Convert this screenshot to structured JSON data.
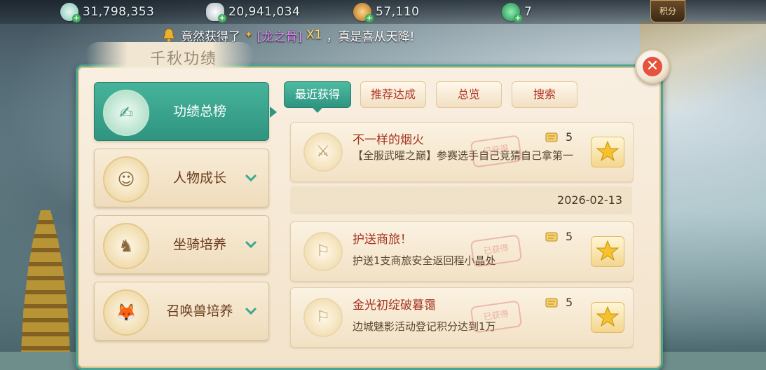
{
  "resources": [
    {
      "icon": "jade-coin-icon",
      "value": "31,798,353",
      "color": "#9ed3c6"
    },
    {
      "icon": "silver-ingot-icon",
      "value": "20,941,034",
      "color": "#cfd8dc"
    },
    {
      "icon": "copper-coin-icon",
      "value": "57,110",
      "color": "#d79a3a"
    },
    {
      "icon": "green-gem-icon",
      "value": "7",
      "color": "#2fae66"
    }
  ],
  "jifen_label": "积分",
  "notice": {
    "prefix": "竟然获得了",
    "item": "[龙之骨]",
    "qty": "X1",
    "suffix": "，真是喜从天降!"
  },
  "panel_title": "千秋功绩",
  "categories": [
    {
      "label": "功绩总榜",
      "active": true
    },
    {
      "label": "人物成长",
      "active": false
    },
    {
      "label": "坐骑培养",
      "active": false
    },
    {
      "label": "召唤兽培养",
      "active": false
    }
  ],
  "tabs": [
    {
      "label": "最近获得",
      "active": true
    },
    {
      "label": "推荐达成",
      "active": false
    },
    {
      "label": "总览",
      "active": false
    },
    {
      "label": "搜索",
      "active": false
    }
  ],
  "entries": [
    {
      "name": "不一样的烟火",
      "desc": "【全服武曜之巅】参赛选手自己竞猜自己拿第一",
      "points": "5",
      "stamp": "已获得"
    },
    {
      "name": "护送商旅！",
      "desc": "护送1支商旅安全返回程小晶处",
      "points": "5",
      "stamp": "已获得"
    },
    {
      "name": "金光初绽破暮霭",
      "desc": "边城魅影活动登记积分达到1万",
      "points": "5",
      "stamp": "已获得"
    }
  ],
  "date_separator": "2026-02-13",
  "colors": {
    "accent": "#2e9580",
    "title_red": "#a3341f",
    "panel_bg": "#f6e8d1"
  }
}
